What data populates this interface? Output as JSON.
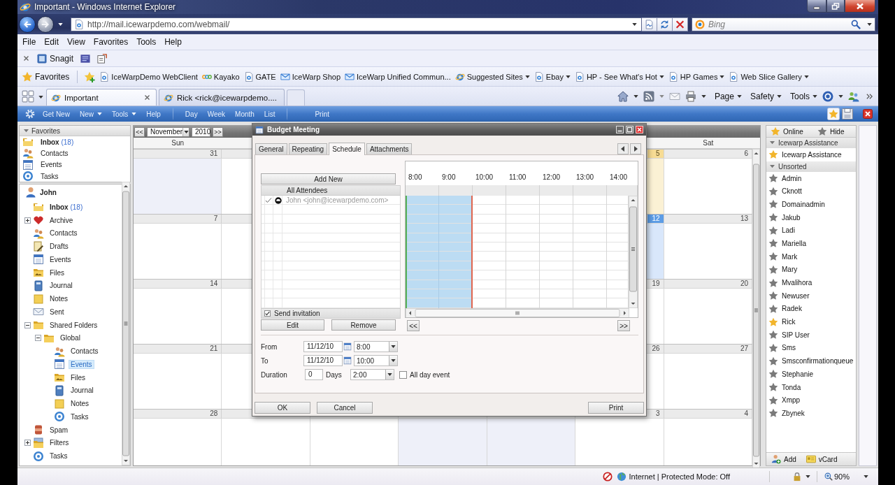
{
  "window": {
    "title": "Important - Windows Internet Explorer"
  },
  "address_bar": {
    "url": "http://mail.icewarpdemo.com/webmail/"
  },
  "search_box": {
    "placeholder": "Bing"
  },
  "menu_bar": [
    "File",
    "Edit",
    "View",
    "Favorites",
    "Tools",
    "Help"
  ],
  "command_bar": {
    "snagit": "Snagit"
  },
  "favorites_bar": {
    "title": "Favorites",
    "links": [
      {
        "label": "IceWarpDemo WebClient",
        "kind": "page",
        "menu": false
      },
      {
        "label": "Kayako",
        "kind": "rings",
        "menu": false
      },
      {
        "label": "GATE",
        "kind": "page",
        "menu": false
      },
      {
        "label": "IceWarp Shop",
        "kind": "mail",
        "menu": false
      },
      {
        "label": "IceWarp Unified Commun...",
        "kind": "mail",
        "menu": false
      },
      {
        "label": "Suggested Sites",
        "kind": "web",
        "menu": true
      },
      {
        "label": "Ebay",
        "kind": "page",
        "menu": true
      },
      {
        "label": "HP - See What's Hot",
        "kind": "page",
        "menu": true
      },
      {
        "label": "HP Games",
        "kind": "page",
        "menu": true
      },
      {
        "label": "Web Slice Gallery",
        "kind": "page",
        "menu": true
      }
    ]
  },
  "browser_tabs": [
    {
      "label": "Important",
      "selected": true
    },
    {
      "label": "Rick <rick@icewarpdemo....",
      "selected": false
    }
  ],
  "command_menus": [
    "Page",
    "Safety",
    "Tools"
  ],
  "app_toolbar": {
    "actions": [
      {
        "label": "Get New",
        "menu": false
      },
      {
        "label": "New",
        "menu": true
      },
      {
        "label": "Tools",
        "menu": true
      },
      {
        "label": "Help",
        "menu": false
      }
    ],
    "views": [
      "Day",
      "Week",
      "Month",
      "List"
    ],
    "print": "Print"
  },
  "sidebar": {
    "favorites": {
      "title": "Favorites",
      "expanded": true,
      "items": [
        {
          "label": "Inbox",
          "count": "(18)",
          "kind": "inbox",
          "selected": false
        },
        {
          "label": "Contacts",
          "kind": "contacts",
          "selected": false
        },
        {
          "label": "Events",
          "kind": "events",
          "selected": false
        },
        {
          "label": "Tasks",
          "kind": "tasks",
          "selected": false
        }
      ]
    },
    "tree": {
      "label": "John",
      "kind": "user",
      "selected": false,
      "children": [
        {
          "label": "Inbox",
          "count": "(18)",
          "kind": "inbox",
          "selected": false
        },
        {
          "label": "Archive",
          "kind": "archive",
          "expanded": false,
          "selected": false
        },
        {
          "label": "Contacts",
          "kind": "contacts",
          "selected": false
        },
        {
          "label": "Drafts",
          "kind": "drafts",
          "selected": false
        },
        {
          "label": "Events",
          "kind": "events",
          "selected": false
        },
        {
          "label": "Files",
          "kind": "files",
          "selected": false
        },
        {
          "label": "Journal",
          "kind": "journal",
          "selected": false
        },
        {
          "label": "Notes",
          "kind": "notes",
          "selected": false
        },
        {
          "label": "Sent",
          "kind": "sent",
          "selected": false
        },
        {
          "label": "Shared Folders",
          "kind": "folder",
          "expanded": true,
          "selected": false,
          "children": [
            {
              "label": "Global",
              "kind": "folder",
              "expanded": true,
              "selected": false,
              "children": [
                {
                  "label": "Contacts",
                  "kind": "contacts",
                  "selected": false
                },
                {
                  "label": "Events",
                  "kind": "events",
                  "selected": true
                },
                {
                  "label": "Files",
                  "kind": "files",
                  "selected": false
                },
                {
                  "label": "Journal",
                  "kind": "journal",
                  "selected": false
                },
                {
                  "label": "Notes",
                  "kind": "notes",
                  "selected": false
                },
                {
                  "label": "Tasks",
                  "kind": "tasks",
                  "selected": false
                }
              ]
            }
          ]
        },
        {
          "label": "Spam",
          "kind": "spam",
          "selected": false
        },
        {
          "label": "Filters",
          "kind": "filters",
          "expanded": false,
          "selected": false
        },
        {
          "label": "Tasks",
          "kind": "tasks",
          "selected": false
        }
      ]
    }
  },
  "calendar": {
    "prev": "<<",
    "month": "November",
    "year": "2010",
    "next": ">>",
    "day_headers": {
      "sun": "Sun",
      "sat": "Sat"
    },
    "weeks": [
      {
        "sun": {
          "date": "31",
          "shaded": true,
          "today": false,
          "selected": false
        },
        "fri": {
          "date": "5",
          "shaded": false,
          "today": true,
          "selected": false
        },
        "sat": {
          "date": "6",
          "shaded": false,
          "today": false,
          "selected": false
        }
      },
      {
        "sun": {
          "date": "7",
          "shaded": false,
          "today": false,
          "selected": false
        },
        "fri": {
          "date": "12",
          "shaded": false,
          "today": false,
          "selected": true
        },
        "sat": {
          "date": "13",
          "shaded": false,
          "today": false,
          "selected": false
        }
      },
      {
        "sun": {
          "date": "14",
          "shaded": false,
          "today": false,
          "selected": false
        },
        "fri": {
          "date": "19",
          "shaded": false,
          "today": false,
          "selected": false
        },
        "sat": {
          "date": "20",
          "shaded": false,
          "today": false,
          "selected": false
        }
      },
      {
        "sun": {
          "date": "21",
          "shaded": false,
          "today": false,
          "selected": false
        },
        "fri": {
          "date": "26",
          "shaded": false,
          "today": false,
          "selected": false
        },
        "sat": {
          "date": "27",
          "shaded": false,
          "today": false,
          "selected": false
        }
      },
      {
        "sun": {
          "date": "28",
          "shaded": false,
          "today": false,
          "selected": false
        },
        "wed": {
          "shaded": true
        },
        "thu": {
          "shaded": true
        },
        "fri": {
          "date": "3",
          "shaded": false,
          "today": false,
          "selected": false
        },
        "sat": {
          "date": "4",
          "shaded": false,
          "today": false,
          "selected": false
        }
      }
    ]
  },
  "dialog": {
    "title": "Budget Meeting",
    "tabs": [
      {
        "label": "General",
        "selected": false
      },
      {
        "label": "Repeating",
        "selected": false
      },
      {
        "label": "Schedule",
        "selected": true
      },
      {
        "label": "Attachments",
        "selected": false
      }
    ],
    "attendees": {
      "add_button": "Add New",
      "header": "All Attendees",
      "rows": [
        {
          "name": "John <john@icewarpdemo.com>",
          "checked": true
        }
      ],
      "send_invitation": {
        "label": "Send invitation",
        "checked": true
      },
      "edit_button": "Edit",
      "remove_button": "Remove"
    },
    "schedule": {
      "hours": [
        {
          "label": "8:00",
          "selected": true
        },
        {
          "label": "9:00",
          "selected": true
        },
        {
          "label": "10:00",
          "selected": false
        },
        {
          "label": "11:00",
          "selected": false
        },
        {
          "label": "12:00",
          "selected": false
        },
        {
          "label": "13:00",
          "selected": false
        },
        {
          "label": "14:00",
          "selected": false
        }
      ],
      "prev": "<<",
      "next": ">>"
    },
    "from": {
      "label": "From",
      "date": "11/12/10",
      "time": "8:00"
    },
    "to": {
      "label": "To",
      "date": "11/12/10",
      "time": "10:00"
    },
    "duration": {
      "label": "Duration",
      "days": "0",
      "unit": "Days",
      "time": "2:00"
    },
    "all_day": {
      "label": "All day event",
      "checked": false
    },
    "buttons": {
      "ok": "OK",
      "cancel": "Cancel",
      "print": "Print"
    }
  },
  "contacts_panel": {
    "presence": [
      {
        "label": "Online",
        "online": true
      },
      {
        "label": "Hide",
        "online": false
      }
    ],
    "groups": [
      {
        "name": "Icewarp Assistance",
        "expanded": true,
        "contacts": [
          {
            "name": "Icewarp Assistance",
            "online": true
          }
        ]
      },
      {
        "name": "Unsorted",
        "expanded": true,
        "contacts": [
          {
            "name": "Admin",
            "online": false
          },
          {
            "name": "Cknott",
            "online": false
          },
          {
            "name": "Domainadmin",
            "online": false
          },
          {
            "name": "Jakub",
            "online": false
          },
          {
            "name": "Ladi",
            "online": false
          },
          {
            "name": "Mariella",
            "online": false
          },
          {
            "name": "Mark",
            "online": false
          },
          {
            "name": "Mary",
            "online": false
          },
          {
            "name": "Mvalihora",
            "online": false
          },
          {
            "name": "Newuser",
            "online": false
          },
          {
            "name": "Radek",
            "online": false
          },
          {
            "name": "Rick",
            "online": true
          },
          {
            "name": "SIP User",
            "online": false
          },
          {
            "name": "Sms",
            "online": false
          },
          {
            "name": "Smsconfirmationqueue",
            "online": false
          },
          {
            "name": "Stephanie",
            "online": false
          },
          {
            "name": "Tonda",
            "online": false
          },
          {
            "name": "Xmpp",
            "online": false
          },
          {
            "name": "Zbynek",
            "online": false
          }
        ]
      }
    ],
    "footer": {
      "add": "Add",
      "vcard": "vCard"
    }
  },
  "status_bar": {
    "zone": "Internet | Protected Mode: Off",
    "zoom": "90%"
  }
}
